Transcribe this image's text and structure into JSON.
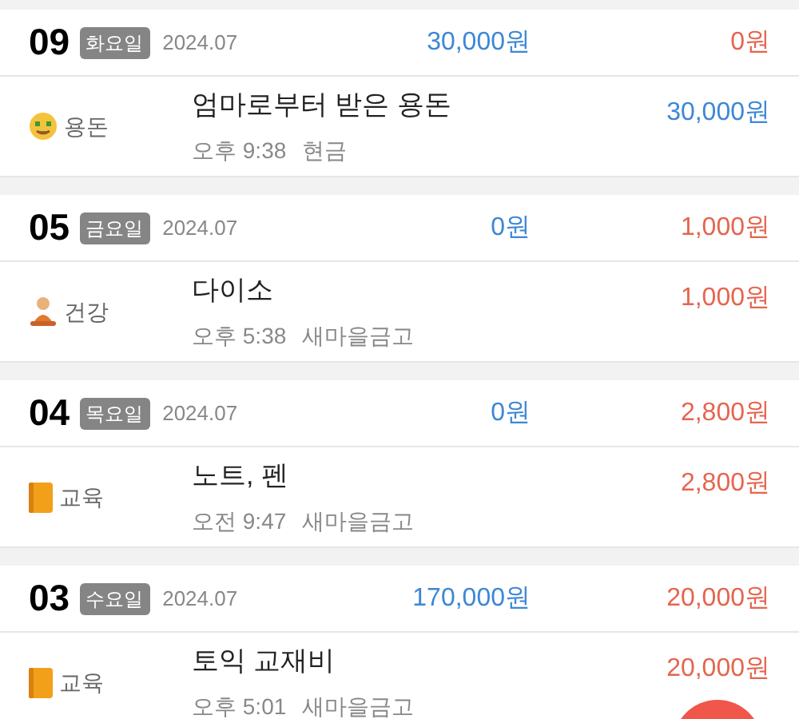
{
  "days": [
    {
      "day": "09",
      "weekday": "화요일",
      "month": "2024.07",
      "income": "30,000원",
      "expense": "0원",
      "entries": [
        {
          "kind": "money",
          "category": "용돈",
          "title": "엄마로부터 받은 용돈",
          "time": "오후 9:38",
          "account": "현금",
          "amount": "30,000원",
          "color": "#3d87d6"
        }
      ]
    },
    {
      "day": "05",
      "weekday": "금요일",
      "month": "2024.07",
      "income": "0원",
      "expense": "1,000원",
      "entries": [
        {
          "kind": "person",
          "category": "건강",
          "title": "다이소",
          "time": "오후 5:38",
          "account": "새마을금고",
          "amount": "1,000원",
          "color": "#e5654f"
        }
      ]
    },
    {
      "day": "04",
      "weekday": "목요일",
      "month": "2024.07",
      "income": "0원",
      "expense": "2,800원",
      "entries": [
        {
          "kind": "book",
          "category": "교육",
          "title": "노트, 펜",
          "time": "오전 9:47",
          "account": "새마을금고",
          "amount": "2,800원",
          "color": "#e5654f"
        }
      ]
    },
    {
      "day": "03",
      "weekday": "수요일",
      "month": "2024.07",
      "income": "170,000원",
      "expense": "20,000원",
      "entries": [
        {
          "kind": "book",
          "category": "교육",
          "title": "토익 교재비",
          "time": "오후 5:01",
          "account": "새마을금고",
          "amount": "20,000원",
          "color": "#e5654f"
        }
      ]
    }
  ]
}
